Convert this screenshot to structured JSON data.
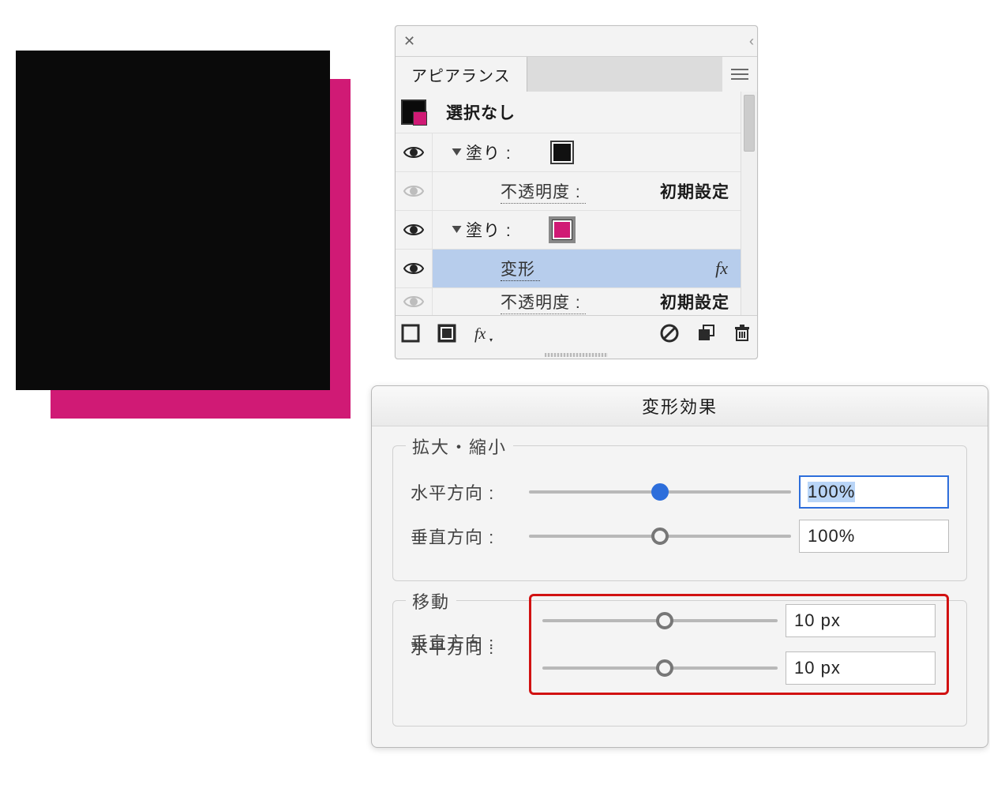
{
  "canvas": {
    "shadow_color": "#d01a75",
    "front_color": "#0a0a0a"
  },
  "appearance_panel": {
    "tab_label": "アピアランス",
    "header_label": "選択なし",
    "rows": {
      "fill1_label": "塗り :",
      "fill1_opacity_label": "不透明度 :",
      "fill1_opacity_value": "初期設定",
      "fill2_label": "塗り :",
      "transform_label": "変形",
      "fx_badge": "fx",
      "fill2_opacity_label": "不透明度 :",
      "fill2_opacity_value": "初期設定"
    }
  },
  "transform_dialog": {
    "title": "変形効果",
    "scale_group": "拡大・縮小",
    "move_group": "移動",
    "h_label": "水平方向 :",
    "v_label": "垂直方向 :",
    "scale_h_value": "100%",
    "scale_v_value": "100%",
    "move_h_value": "10 px",
    "move_v_value": "10 px"
  }
}
